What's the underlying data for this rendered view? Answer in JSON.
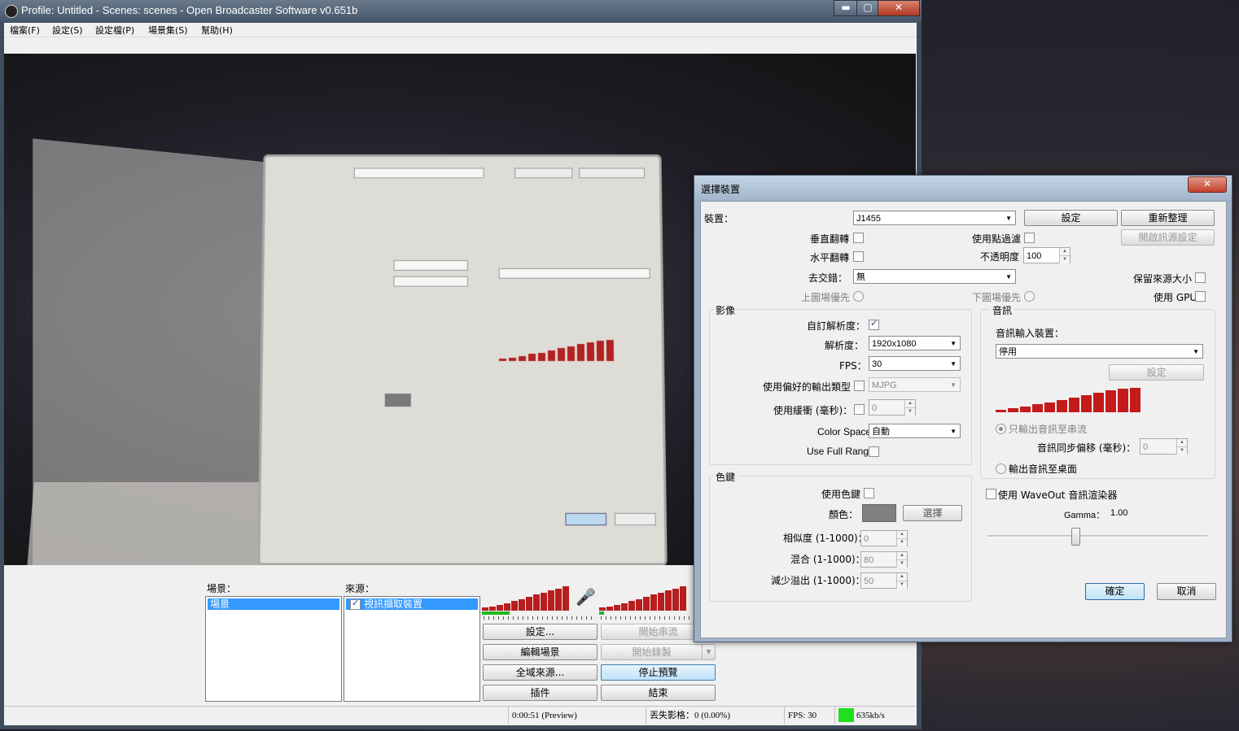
{
  "window": {
    "title": "Profile: Untitled - Scenes: scenes - Open Broadcaster Software v0.651b"
  },
  "menu": [
    "檔案(F)",
    "設定(S)",
    "設定檔(P)",
    "場景集(S)",
    "幫助(H)"
  ],
  "scenes": {
    "label": "場景：",
    "items": [
      "場景"
    ]
  },
  "sources": {
    "label": "來源：",
    "items": [
      "視訊擷取裝置"
    ]
  },
  "buttons": {
    "settings": "設定...",
    "start_stream": "開始串流",
    "edit_scene": "編輯場景",
    "start_record": "開始錄製",
    "global_sources": "全域來源...",
    "stop_preview": "停止預覽",
    "plugins": "插件",
    "exit": "結束"
  },
  "meters": {
    "mic": [
      3,
      4,
      5,
      7,
      9,
      11,
      13,
      15,
      17,
      19,
      21,
      23
    ],
    "desktop": [
      3,
      4,
      5,
      7,
      9,
      11,
      13,
      15,
      17,
      19,
      21,
      23
    ]
  },
  "status": {
    "time": "0:00:51 (Preview)",
    "dropped": "丟失影格：0 (0.00%)",
    "fps": "FPS: 30",
    "bitrate": "635kb/s",
    "bitrate_color": "#1fe01f"
  },
  "dialog": {
    "title": "選擇裝置",
    "close": "✕",
    "device_label": "裝置：",
    "device_value": "J1455",
    "config_btn": "設定",
    "refresh_btn": "重新整理",
    "flip_vertical": "垂直翻轉",
    "use_point_filter": "使用點過濾",
    "open_source_config": "開啟訊源設定",
    "flip_horizontal": "水平翻轉",
    "opacity_label": "不透明度",
    "opacity_value": "100",
    "deinterlace_label": "去交錯：",
    "deinterlace_value": "無",
    "keep_source_size": "保留來源大小",
    "top_field_first": "上圖場優先",
    "bottom_field_first": "下圖場優先",
    "use_gpu": "使用 GPU",
    "video_group": "影像",
    "custom_resolution": "自訂解析度：",
    "resolution_label": "解析度：",
    "resolution_value": "1920x1080",
    "fps_label": "FPS：",
    "fps_value": "30",
    "preferred_output": "使用偏好的輸出類型",
    "output_type_value": "MJPG",
    "use_buffer": "使用緩衝 (毫秒)：",
    "buffer_value": "0",
    "color_space_label": "Color Space",
    "color_space_value": "自動",
    "full_range": "Use Full Range",
    "audio_group": "音訊",
    "audio_input_label": "音訊輸入裝置：",
    "audio_input_value": "停用",
    "audio_config_btn": "設定",
    "audio_meter": [
      3,
      5,
      7,
      10,
      12,
      15,
      18,
      21,
      24,
      27,
      29,
      30
    ],
    "output_stream_only": "只輸出音訊至串流",
    "audio_offset_label": "音訊同步偏移 (毫秒)：",
    "audio_offset_value": "0",
    "output_desktop": "輸出音訊至桌面",
    "colorkey_group": "色鍵",
    "use_colorkey": "使用色鍵",
    "color_label": "顏色：",
    "color_swatch": "#808080",
    "select_btn": "選擇",
    "similarity_label": "相似度 (1-1000)：",
    "similarity_value": "0",
    "blend_label": "混合 (1-1000)：",
    "blend_value": "80",
    "spill_label": "減少溢出 (1-1000)：",
    "spill_value": "50",
    "waveout": "使用 WaveOut 音訊渲染器",
    "gamma_label": "Gamma：",
    "gamma_value": "1.00",
    "ok_btn": "確定",
    "cancel_btn": "取消"
  }
}
